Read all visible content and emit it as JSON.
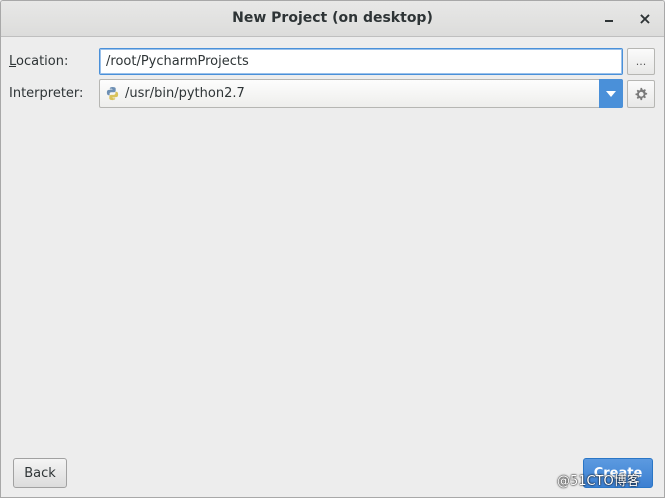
{
  "window": {
    "title": "New Project (on desktop)",
    "minimize_icon": "minimize-icon",
    "close_glyph": "×"
  },
  "location": {
    "label_mnemonic": "L",
    "label_rest": "ocation:",
    "value": "/root/PycharmProjects",
    "browse_label": "..."
  },
  "interpreter": {
    "label": "Interpreter:",
    "value": "/usr/bin/python2.7",
    "icon": "python-icon",
    "settings_icon": "gear-icon"
  },
  "buttons": {
    "back": "Back",
    "create": "Create"
  },
  "watermark": "@51CTO博客",
  "colors": {
    "accent": "#4a90d9",
    "background": "#ededed"
  }
}
